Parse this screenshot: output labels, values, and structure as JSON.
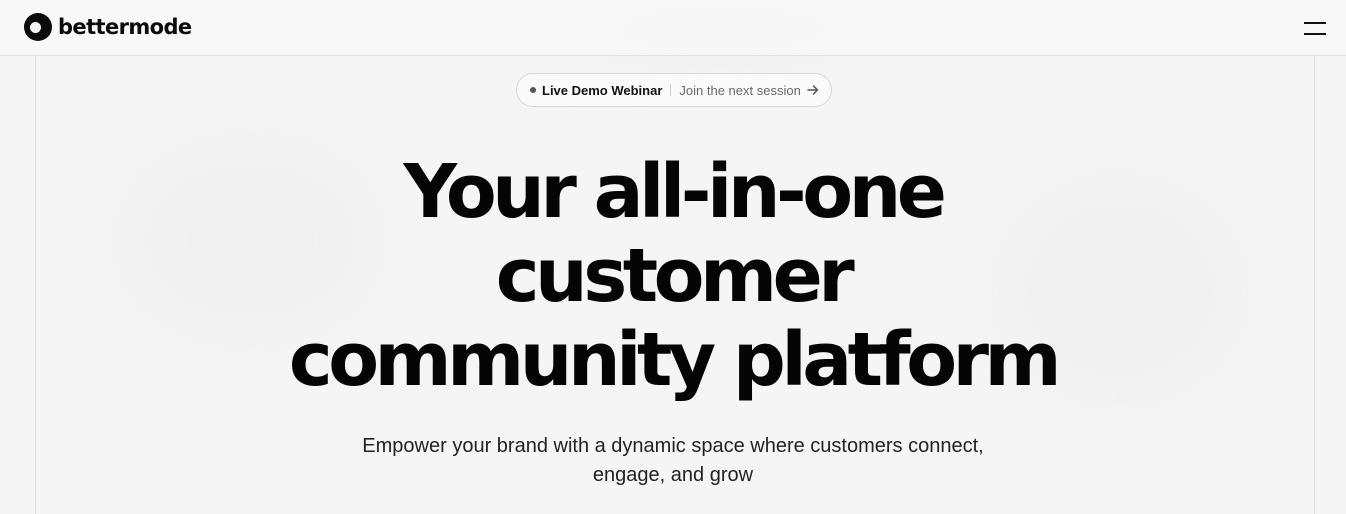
{
  "header": {
    "brand_name": "bettermode",
    "logo_icon": "bettermode-logo-icon",
    "menu_icon": "hamburger-menu-icon"
  },
  "announcement": {
    "label": "Live Demo Webinar",
    "cta": "Join the next session",
    "arrow_icon": "arrow-right-icon"
  },
  "hero": {
    "headline_lines": [
      "Your all-in-one",
      "customer",
      "community platform"
    ],
    "subheadline_lines": [
      "Empower your brand with a dynamic space where customers connect,",
      "engage, and grow"
    ]
  },
  "colors": {
    "background": "#f5f5f5",
    "text_primary": "#050505",
    "text_secondary": "#6a6a6a",
    "border": "#dcdcdc"
  }
}
